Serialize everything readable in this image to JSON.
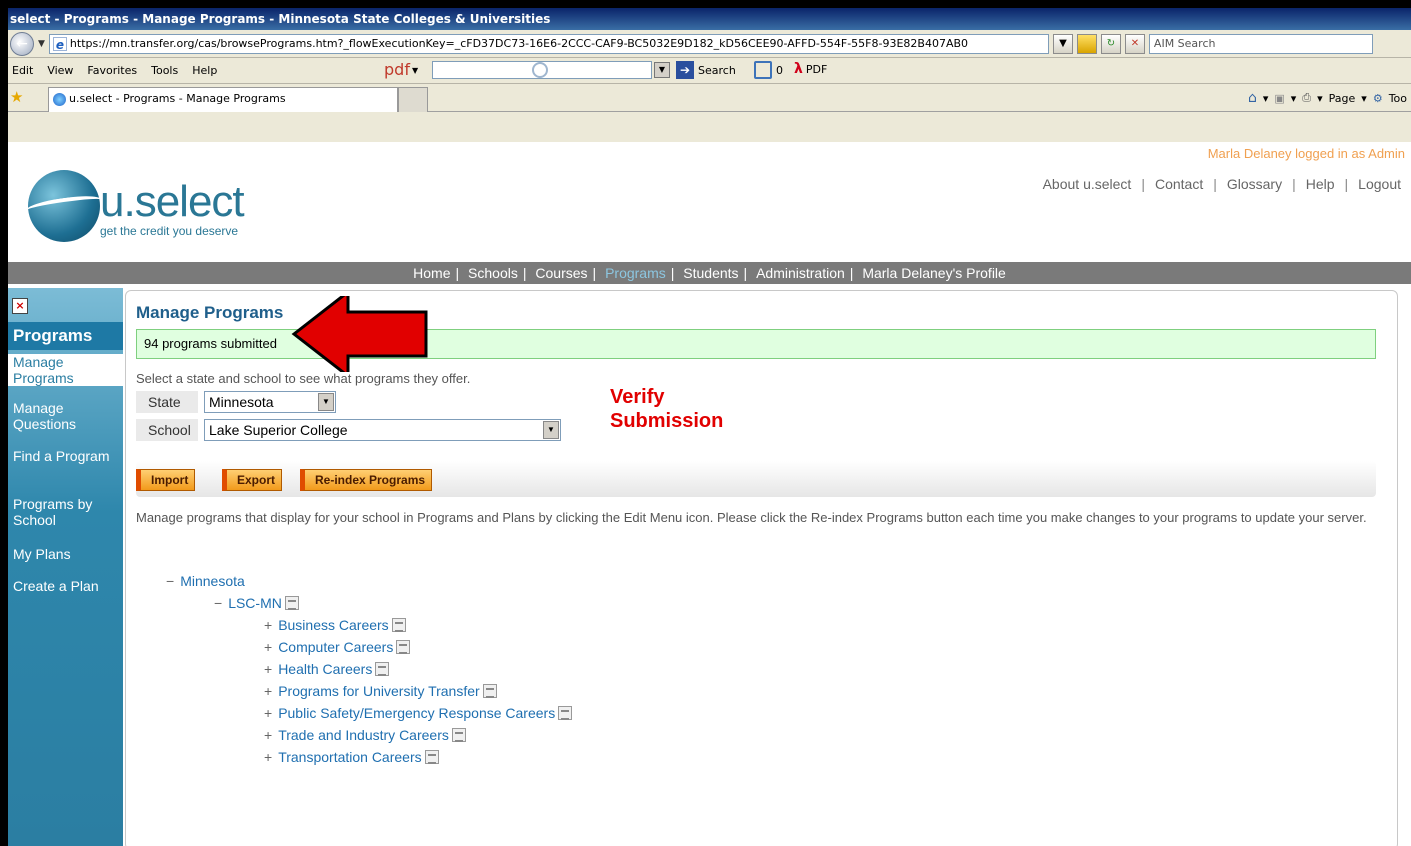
{
  "browser": {
    "title": "select - Programs - Manage Programs - Minnesota State Colleges & Universities",
    "url": "https://mn.transfer.org/cas/browsePrograms.htm?_flowExecutionKey=_cFD37DC73-16E6-2CCC-CAF9-BC5032E9D182_kD56CEE90-AFFD-554F-55F8-93E82B407AB0",
    "search_provider": "AIM Search",
    "menu": [
      "Edit",
      "View",
      "Favorites",
      "Tools",
      "Help"
    ],
    "pdf_label": "pdf",
    "search_label": "Search",
    "count_value": "0",
    "pdf_button": "PDF",
    "tab_title": "u.select - Programs - Manage Programs",
    "tools_right": [
      "Page",
      "Too"
    ]
  },
  "site": {
    "logo_text": "u.select",
    "tagline": "get the credit you deserve",
    "logged_in": "Marla Delaney logged in as Admin",
    "top_links": [
      "About u.select",
      "Contact",
      "Glossary",
      "Help",
      "Logout"
    ],
    "nav": [
      "Home",
      "Schools",
      "Courses",
      "Programs",
      "Students",
      "Administration",
      "Marla Delaney's Profile"
    ],
    "nav_active": "Programs"
  },
  "sidebar": {
    "close_glyph": "×",
    "title": "Programs",
    "items": [
      "Manage Programs",
      "Manage Questions",
      "Find a Program",
      "Programs by School",
      "My Plans",
      "Create a Plan"
    ]
  },
  "content": {
    "title": "Manage Programs",
    "message": "94 programs submitted",
    "instructions": "Select a state and school to see what programs they offer.",
    "state_label": "State",
    "state_value": "Minnesota",
    "school_label": "School",
    "school_value": "Lake Superior College",
    "callout_line1": "Verify",
    "callout_line2": "Submission",
    "buttons": [
      "Import",
      "Export",
      "Re-index Programs"
    ],
    "description": "Manage programs that display for your school in Programs and Plans by clicking the Edit Menu icon.   Please click the Re-index Programs button each time you make changes to your programs to update your server.",
    "tree": {
      "root": "Minnesota",
      "org": "LSC-MN",
      "programs": [
        "Business Careers",
        "Computer Careers",
        "Health Careers",
        "Programs for University Transfer",
        "Public Safety/Emergency Response Careers",
        "Trade and Industry Careers",
        "Transportation Careers"
      ]
    }
  },
  "colors": {
    "accent": "#2b7ea2",
    "arrow": "#e10000",
    "success_bg": "#e0ffe0"
  }
}
